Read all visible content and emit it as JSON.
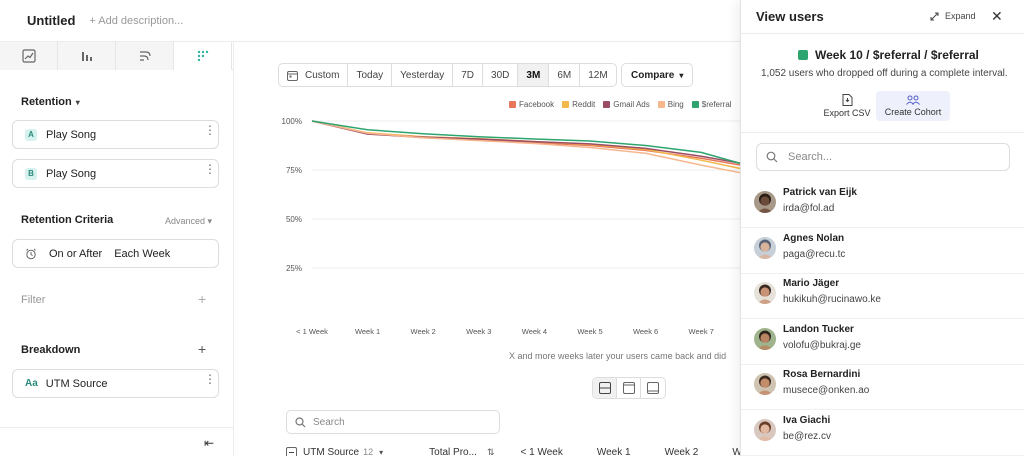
{
  "header": {
    "title": "Untitled",
    "description_placeholder": "+ Add description..."
  },
  "left": {
    "tabs": [
      "insights-icon",
      "bar-chart-icon",
      "flows-icon",
      "retention-icon"
    ],
    "retention_label": "Retention",
    "events": [
      {
        "letter": "A",
        "name": "Play Song"
      },
      {
        "letter": "B",
        "name": "Play Song"
      }
    ],
    "criteria_label": "Retention Criteria",
    "criteria_mode": "Advanced",
    "criteria_when": "On or After",
    "criteria_period": "Each Week",
    "filter_label": "Filter",
    "breakdown_label": "Breakdown",
    "breakdown_prefix": "Aa",
    "breakdown_value": "UTM Source"
  },
  "toolbar": {
    "ranges": [
      "Custom",
      "Today",
      "Yesterday",
      "7D",
      "30D",
      "3M",
      "6M",
      "12M"
    ],
    "active_range": "3M",
    "compare_label": "Compare"
  },
  "chart_data": {
    "type": "line",
    "x": [
      "< 1 Week",
      "Week 1",
      "Week 2",
      "Week 3",
      "Week 4",
      "Week 5",
      "Week 6",
      "Week 7"
    ],
    "y_ticks": [
      "100%",
      "75%",
      "50%",
      "25%"
    ],
    "ylim": [
      0,
      100
    ],
    "grid": true,
    "legend_position": "top",
    "series": [
      {
        "name": "Facebook",
        "color": "#e8765a",
        "values": [
          100,
          93.5,
          91.5,
          90.5,
          89,
          87.5,
          85,
          81,
          76
        ]
      },
      {
        "name": "Reddit",
        "color": "#f3b74a",
        "values": [
          100,
          94,
          92,
          91,
          89.5,
          88,
          85.5,
          80,
          74
        ]
      },
      {
        "name": "Gmail Ads",
        "color": "#9b4d63",
        "values": [
          100,
          93.3,
          91.8,
          90.8,
          89.5,
          88.3,
          86,
          82,
          77
        ]
      },
      {
        "name": "Bing",
        "color": "#f6b78f",
        "values": [
          100,
          93.8,
          91.5,
          90,
          88.5,
          86.5,
          83.5,
          77.5,
          72
        ]
      },
      {
        "name": "$referral",
        "color": "#2ea46f",
        "values": [
          100,
          95.5,
          93.5,
          92,
          90.8,
          89.8,
          87.5,
          84,
          76
        ]
      }
    ],
    "caption": "X and more weeks later your users came back and did"
  },
  "table": {
    "search_placeholder": "Search",
    "col_source": "UTM Source",
    "col_source_count": "12",
    "col_total": "Total Pro...",
    "col_weeks": [
      "< 1 Week",
      "Week 1",
      "Week 2",
      "We"
    ]
  },
  "drawer": {
    "title": "View users",
    "expand_label": "Expand",
    "cohort_title": "Week 10 / $referral / $referral",
    "cohort_subtitle": "1,052 users who dropped off during a complete interval.",
    "export_label": "Export CSV",
    "create_label": "Create Cohort",
    "search_placeholder": "Search...",
    "users": [
      {
        "name": "Patrick van Eijk",
        "email": "irda@fol.ad",
        "skin": "#6b4a3a",
        "hair": "#2a1d16",
        "bg": "#a89888"
      },
      {
        "name": "Agnes Nolan",
        "email": "paga@recu.tc",
        "skin": "#d9b39a",
        "hair": "#5a6275",
        "bg": "#c7cfd8"
      },
      {
        "name": "Mario Jäger",
        "email": "hukikuh@rucinawo.ke",
        "skin": "#c99476",
        "hair": "#3a2a22",
        "bg": "#e6e2da"
      },
      {
        "name": "Landon Tucker",
        "email": "volofu@bukraj.ge",
        "skin": "#b98462",
        "hair": "#2e241c",
        "bg": "#9fb38c"
      },
      {
        "name": "Rosa Bernardini",
        "email": "musece@onken.ao",
        "skin": "#c48c6a",
        "hair": "#3b2b20",
        "bg": "#cfc3b1"
      },
      {
        "name": "Iva Giachi",
        "email": "be@rez.cv",
        "skin": "#e2b8a0",
        "hair": "#6a3f2a",
        "bg": "#d9c8c0"
      }
    ]
  }
}
